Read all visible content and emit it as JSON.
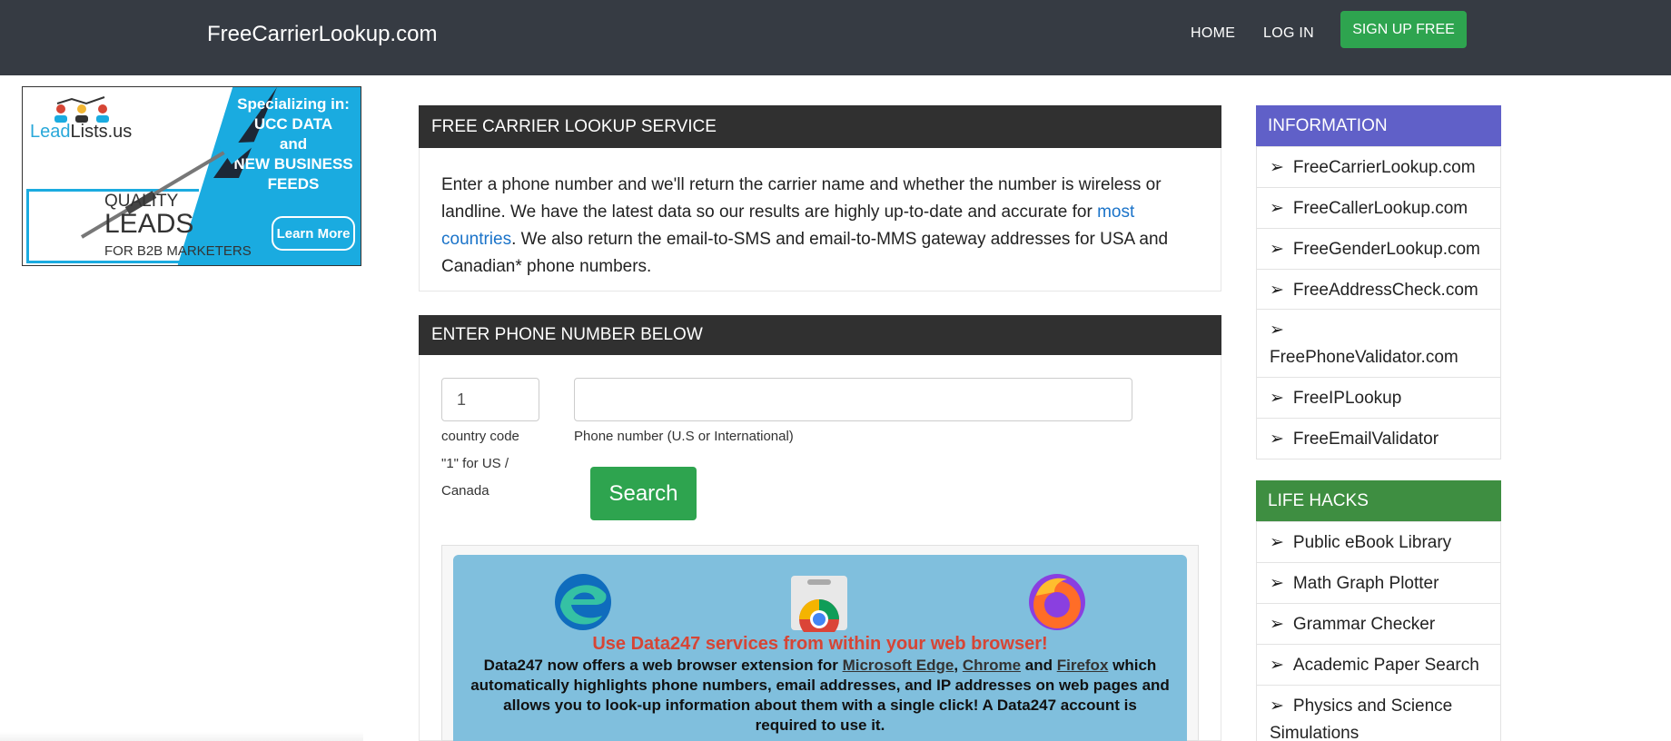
{
  "header": {
    "brand": "FreeCarrierLookup.com",
    "nav": {
      "home": "HOME",
      "login": "LOG IN",
      "signup": "SIGN UP FREE"
    }
  },
  "ad": {
    "brand_prefix": "Lead",
    "brand_suffix": "Lists.us",
    "heading_line1": "Specializing in:",
    "heading_line2": "UCC DATA",
    "heading_line3": "and",
    "heading_line4": "NEW BUSINESS",
    "heading_line5": "FEEDS",
    "quality": "QUALITY",
    "leads": "LEADS",
    "b2b": "FOR B2B MARKETERS",
    "learn_more": "Learn More",
    "accent_color": "#1aabe0"
  },
  "main": {
    "service_panel": {
      "title": "FREE CARRIER LOOKUP SERVICE",
      "text_part1": "Enter a phone number and we'll return the carrier name and whether the number is wireless or landline. We have the latest data so our results are highly up-to-date and accurate for ",
      "link": "most countries",
      "text_part2": ". We also return the email-to-SMS and email-to-MMS gateway addresses for USA and Canadian* phone numbers."
    },
    "form_panel": {
      "title": "ENTER PHONE NUMBER BELOW",
      "country_code_value": "1",
      "country_code_label1": "country code",
      "country_code_label2": "\"1\" for US /",
      "country_code_label3": "Canada",
      "phone_label": "Phone number (U.S or International)",
      "phone_value": "",
      "search_button": "Search"
    },
    "extension_box": {
      "icons": [
        "edge-icon",
        "chrome-web-store-icon",
        "firefox-icon"
      ],
      "title": "Use Data247 services from within your web browser!",
      "desc_part1": "Data247 now offers a web browser extension for ",
      "edge_link": "Microsoft Edge",
      "sep1": ", ",
      "chrome_link": "Chrome",
      "sep2": " and ",
      "firefox_link": "Firefox",
      "desc_part2": " which automatically highlights phone numbers, email addresses, and IP addresses on web pages and allows you to look-up information about them with a single click! A Data247 account is required to use it."
    }
  },
  "sidebar": {
    "information": {
      "title": "INFORMATION",
      "color": "#6060c8",
      "items": [
        {
          "arrow": "➢",
          "label": "FreeCarrierLookup.com"
        },
        {
          "arrow": "➢",
          "label": "FreeCallerLookup.com"
        },
        {
          "arrow": "➢",
          "label": "FreeGenderLookup.com"
        },
        {
          "arrow": "➢",
          "label": "FreeAddressCheck.com"
        },
        {
          "arrow": "➢",
          "label": "FreePhoneValidator.com"
        },
        {
          "arrow": "➢",
          "label": "FreeIPLookup"
        },
        {
          "arrow": "➢",
          "label": "FreeEmailValidator"
        }
      ]
    },
    "life_hacks": {
      "title": "LIFE HACKS",
      "color": "#3e8e41",
      "items": [
        {
          "arrow": "➢",
          "label": "Public eBook Library"
        },
        {
          "arrow": "➢",
          "label": "Math Graph Plotter"
        },
        {
          "arrow": "➢",
          "label": "Grammar Checker"
        },
        {
          "arrow": "➢",
          "label": "Academic Paper Search"
        },
        {
          "arrow": "➢",
          "label": "Physics and Science Simulations"
        }
      ]
    }
  },
  "colors": {
    "navbar": "#363b43",
    "green_button": "#2ea44f",
    "panel_header": "#303030",
    "link": "#1a73c9"
  }
}
